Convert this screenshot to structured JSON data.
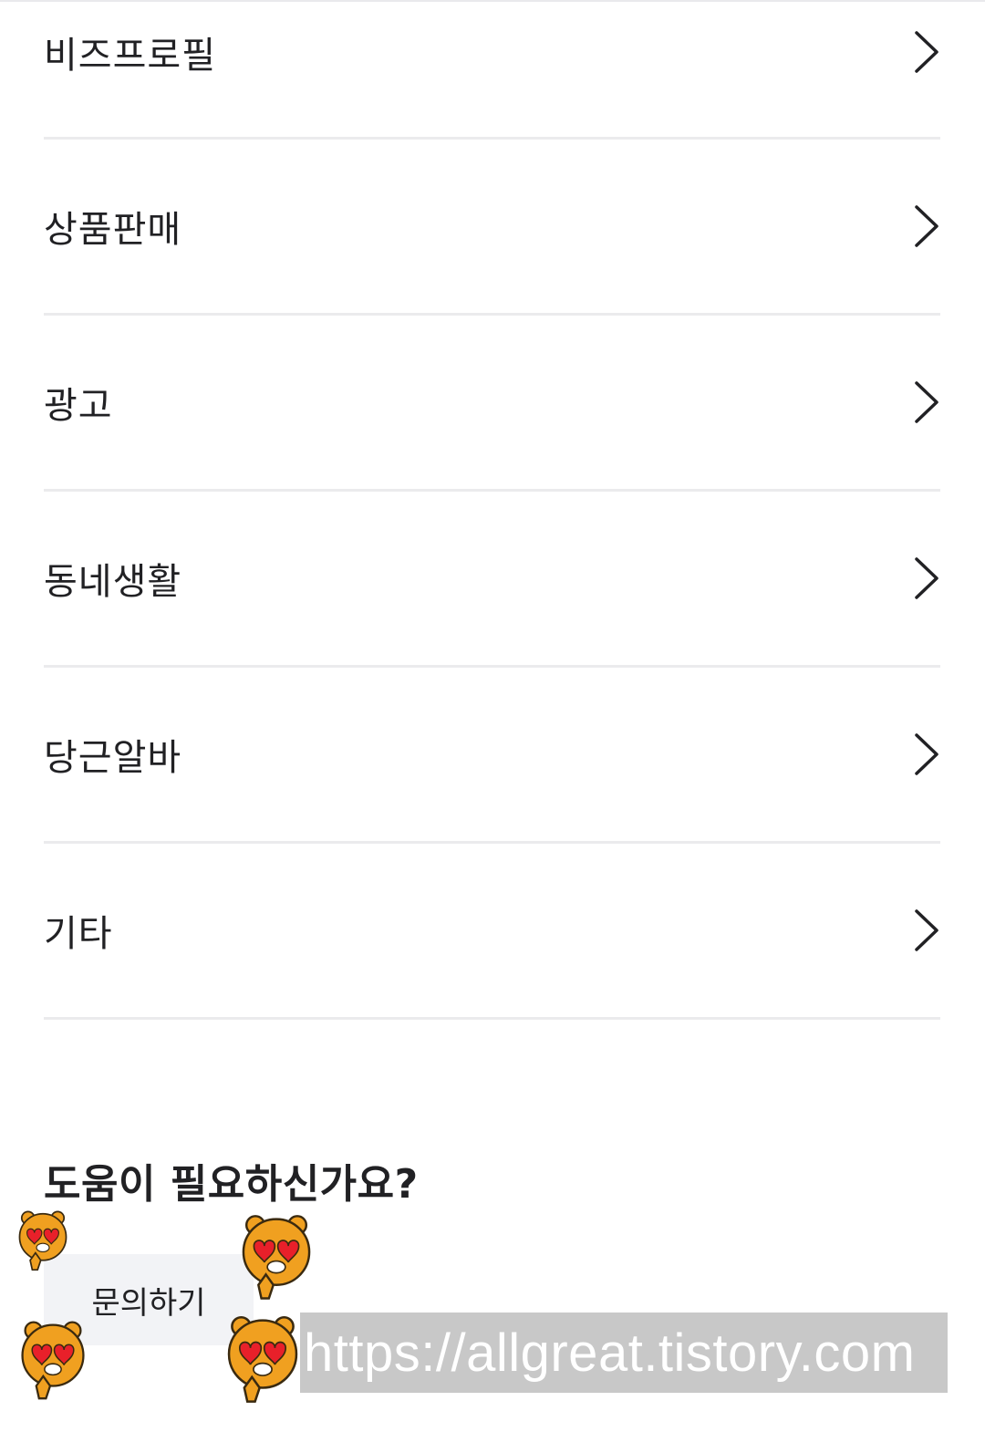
{
  "menu": {
    "items": [
      {
        "label": "비즈프로필"
      },
      {
        "label": "상품판매"
      },
      {
        "label": "광고"
      },
      {
        "label": "동네생활"
      },
      {
        "label": "당근알바"
      },
      {
        "label": "기타"
      }
    ]
  },
  "help": {
    "title": "도움이 필요하신가요?",
    "contact_button_label": "문의하기"
  },
  "watermark": {
    "text": "https://allgreat.tistory.com"
  },
  "colors": {
    "text": "#212124",
    "divider": "#ebebed",
    "button_bg": "#f2f3f6",
    "watermark_bg": "#c8c8c8",
    "sticker_body": "#f0a020",
    "sticker_heart": "#e8202a"
  },
  "icons": {
    "menu_chevron": "chevron-right-icon",
    "sticker": "heart-eyes-lion-sticker"
  }
}
